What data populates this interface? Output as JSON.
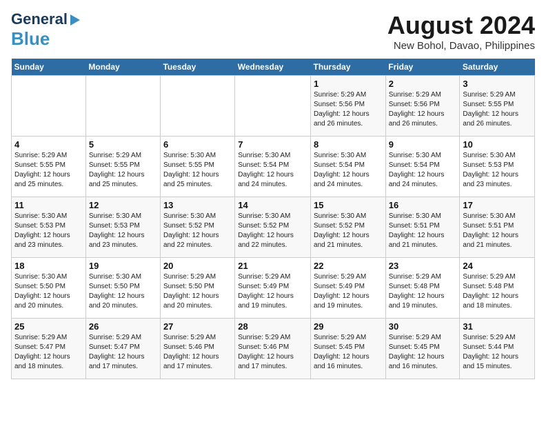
{
  "header": {
    "logo_line1": "General",
    "logo_line2": "Blue",
    "month_year": "August 2024",
    "location": "New Bohol, Davao, Philippines"
  },
  "days_of_week": [
    "Sunday",
    "Monday",
    "Tuesday",
    "Wednesday",
    "Thursday",
    "Friday",
    "Saturday"
  ],
  "weeks": [
    [
      {
        "day": "",
        "text": ""
      },
      {
        "day": "",
        "text": ""
      },
      {
        "day": "",
        "text": ""
      },
      {
        "day": "",
        "text": ""
      },
      {
        "day": "1",
        "text": "Sunrise: 5:29 AM\nSunset: 5:56 PM\nDaylight: 12 hours\nand 26 minutes."
      },
      {
        "day": "2",
        "text": "Sunrise: 5:29 AM\nSunset: 5:56 PM\nDaylight: 12 hours\nand 26 minutes."
      },
      {
        "day": "3",
        "text": "Sunrise: 5:29 AM\nSunset: 5:55 PM\nDaylight: 12 hours\nand 26 minutes."
      }
    ],
    [
      {
        "day": "4",
        "text": "Sunrise: 5:29 AM\nSunset: 5:55 PM\nDaylight: 12 hours\nand 25 minutes."
      },
      {
        "day": "5",
        "text": "Sunrise: 5:29 AM\nSunset: 5:55 PM\nDaylight: 12 hours\nand 25 minutes."
      },
      {
        "day": "6",
        "text": "Sunrise: 5:30 AM\nSunset: 5:55 PM\nDaylight: 12 hours\nand 25 minutes."
      },
      {
        "day": "7",
        "text": "Sunrise: 5:30 AM\nSunset: 5:54 PM\nDaylight: 12 hours\nand 24 minutes."
      },
      {
        "day": "8",
        "text": "Sunrise: 5:30 AM\nSunset: 5:54 PM\nDaylight: 12 hours\nand 24 minutes."
      },
      {
        "day": "9",
        "text": "Sunrise: 5:30 AM\nSunset: 5:54 PM\nDaylight: 12 hours\nand 24 minutes."
      },
      {
        "day": "10",
        "text": "Sunrise: 5:30 AM\nSunset: 5:53 PM\nDaylight: 12 hours\nand 23 minutes."
      }
    ],
    [
      {
        "day": "11",
        "text": "Sunrise: 5:30 AM\nSunset: 5:53 PM\nDaylight: 12 hours\nand 23 minutes."
      },
      {
        "day": "12",
        "text": "Sunrise: 5:30 AM\nSunset: 5:53 PM\nDaylight: 12 hours\nand 23 minutes."
      },
      {
        "day": "13",
        "text": "Sunrise: 5:30 AM\nSunset: 5:52 PM\nDaylight: 12 hours\nand 22 minutes."
      },
      {
        "day": "14",
        "text": "Sunrise: 5:30 AM\nSunset: 5:52 PM\nDaylight: 12 hours\nand 22 minutes."
      },
      {
        "day": "15",
        "text": "Sunrise: 5:30 AM\nSunset: 5:52 PM\nDaylight: 12 hours\nand 21 minutes."
      },
      {
        "day": "16",
        "text": "Sunrise: 5:30 AM\nSunset: 5:51 PM\nDaylight: 12 hours\nand 21 minutes."
      },
      {
        "day": "17",
        "text": "Sunrise: 5:30 AM\nSunset: 5:51 PM\nDaylight: 12 hours\nand 21 minutes."
      }
    ],
    [
      {
        "day": "18",
        "text": "Sunrise: 5:30 AM\nSunset: 5:50 PM\nDaylight: 12 hours\nand 20 minutes."
      },
      {
        "day": "19",
        "text": "Sunrise: 5:30 AM\nSunset: 5:50 PM\nDaylight: 12 hours\nand 20 minutes."
      },
      {
        "day": "20",
        "text": "Sunrise: 5:29 AM\nSunset: 5:50 PM\nDaylight: 12 hours\nand 20 minutes."
      },
      {
        "day": "21",
        "text": "Sunrise: 5:29 AM\nSunset: 5:49 PM\nDaylight: 12 hours\nand 19 minutes."
      },
      {
        "day": "22",
        "text": "Sunrise: 5:29 AM\nSunset: 5:49 PM\nDaylight: 12 hours\nand 19 minutes."
      },
      {
        "day": "23",
        "text": "Sunrise: 5:29 AM\nSunset: 5:48 PM\nDaylight: 12 hours\nand 19 minutes."
      },
      {
        "day": "24",
        "text": "Sunrise: 5:29 AM\nSunset: 5:48 PM\nDaylight: 12 hours\nand 18 minutes."
      }
    ],
    [
      {
        "day": "25",
        "text": "Sunrise: 5:29 AM\nSunset: 5:47 PM\nDaylight: 12 hours\nand 18 minutes."
      },
      {
        "day": "26",
        "text": "Sunrise: 5:29 AM\nSunset: 5:47 PM\nDaylight: 12 hours\nand 17 minutes."
      },
      {
        "day": "27",
        "text": "Sunrise: 5:29 AM\nSunset: 5:46 PM\nDaylight: 12 hours\nand 17 minutes."
      },
      {
        "day": "28",
        "text": "Sunrise: 5:29 AM\nSunset: 5:46 PM\nDaylight: 12 hours\nand 17 minutes."
      },
      {
        "day": "29",
        "text": "Sunrise: 5:29 AM\nSunset: 5:45 PM\nDaylight: 12 hours\nand 16 minutes."
      },
      {
        "day": "30",
        "text": "Sunrise: 5:29 AM\nSunset: 5:45 PM\nDaylight: 12 hours\nand 16 minutes."
      },
      {
        "day": "31",
        "text": "Sunrise: 5:29 AM\nSunset: 5:44 PM\nDaylight: 12 hours\nand 15 minutes."
      }
    ]
  ]
}
